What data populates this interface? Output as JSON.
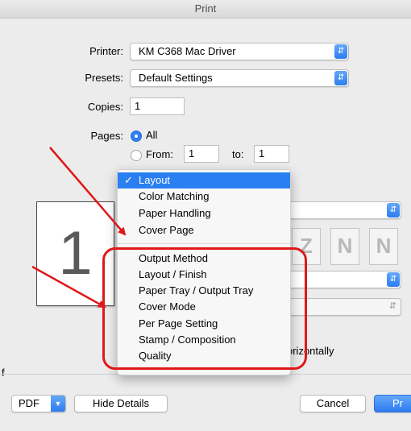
{
  "window": {
    "title": "Print"
  },
  "printer": {
    "label": "Printer:",
    "value": "KM C368 Mac Driver"
  },
  "presets": {
    "label": "Presets:",
    "value": "Default Settings"
  },
  "copies": {
    "label": "Copies:",
    "value": "1"
  },
  "pages": {
    "label": "Pages:",
    "all_label": "All",
    "from_label": "From:",
    "from_value": "1",
    "to_label": "to:",
    "to_value": "1",
    "selected": "All"
  },
  "preview": {
    "page_number": "1"
  },
  "background": {
    "layout_icons": [
      "Z",
      "N",
      "N"
    ],
    "orientation_fragment": "orizontally",
    "left_fragment": "f"
  },
  "menu": {
    "selected": "Layout",
    "check": "✓",
    "group1": [
      "Layout",
      "Color Matching",
      "Paper Handling",
      "Cover Page"
    ],
    "group2": [
      "Output Method",
      "Layout / Finish",
      "Paper Tray / Output Tray",
      "Cover Mode",
      "Per Page Setting",
      "Stamp / Composition",
      "Quality"
    ]
  },
  "footer": {
    "pdf_label": "PDF",
    "hide_details_label": "Hide Details",
    "cancel_label": "Cancel",
    "print_label": "Pr"
  },
  "annotations": {
    "arrow_color": "#e01818",
    "highlight_color": "#e01818"
  },
  "colors": {
    "accent": "#2a7ff3"
  }
}
